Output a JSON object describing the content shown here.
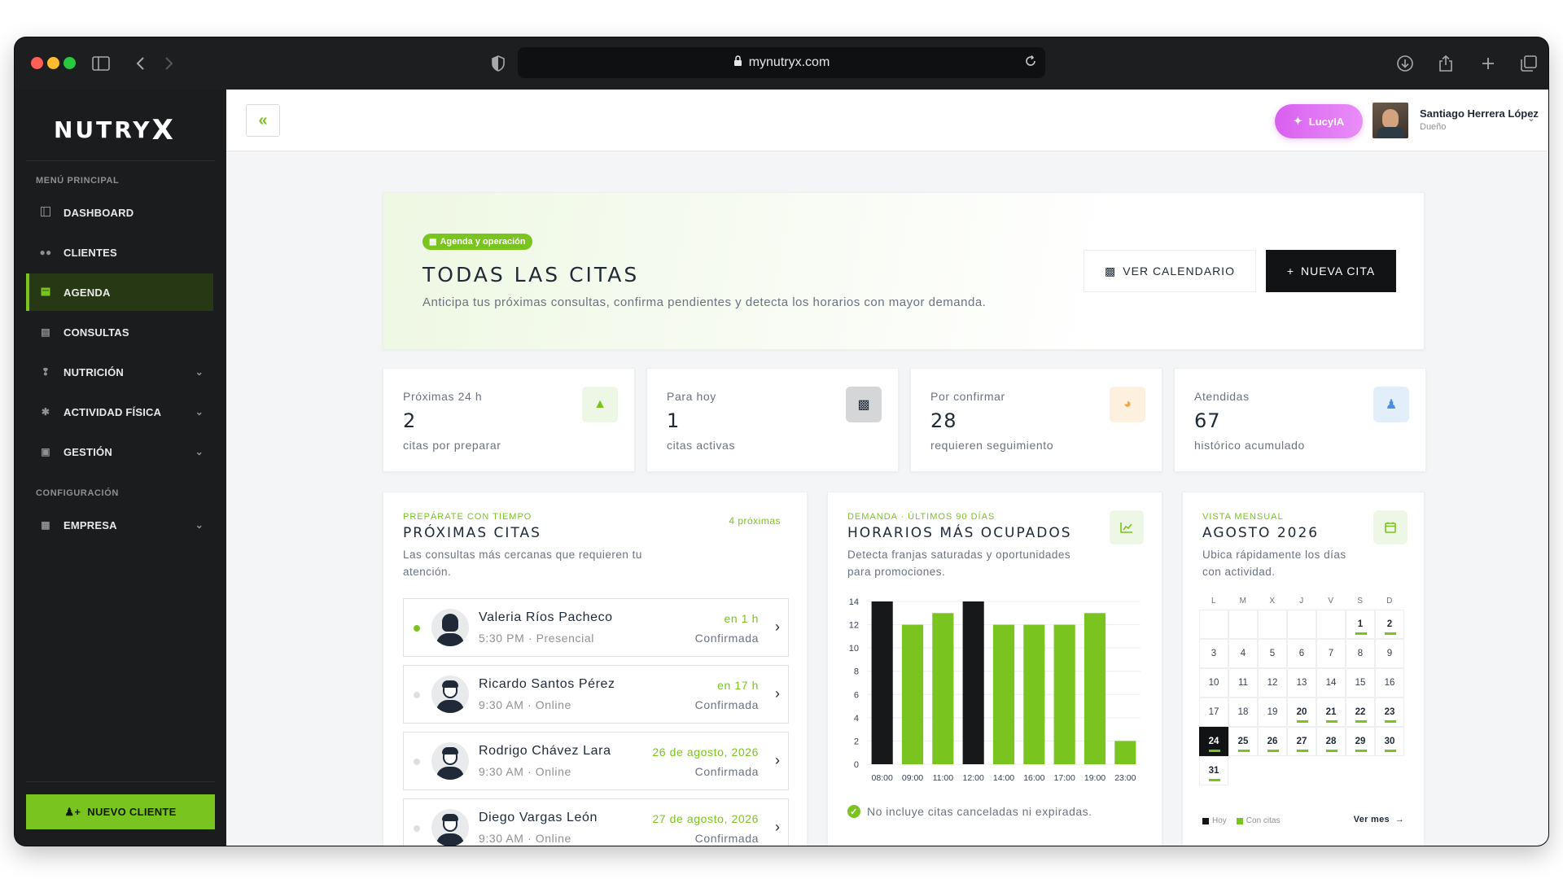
{
  "browser": {
    "url": "mynutryx.com"
  },
  "brand": {
    "logo_text": "NUTRY",
    "logo_x": "X",
    "accent": "#7ac41f",
    "dark": "#1a1c1d"
  },
  "sidebar": {
    "section_main": "MENÚ PRINCIPAL",
    "section_config": "CONFIGURACIÓN",
    "items": [
      {
        "label": "DASHBOARD",
        "icon": "dashboard-icon",
        "active": false,
        "expandable": false
      },
      {
        "label": "CLIENTES",
        "icon": "users-icon",
        "active": false,
        "expandable": false
      },
      {
        "label": "AGENDA",
        "icon": "calendar-icon",
        "active": true,
        "expandable": false
      },
      {
        "label": "CONSULTAS",
        "icon": "clipboard-icon",
        "active": false,
        "expandable": false
      },
      {
        "label": "NUTRICIÓN",
        "icon": "utensils-icon",
        "active": false,
        "expandable": true
      },
      {
        "label": "ACTIVIDAD FÍSICA",
        "icon": "running-icon",
        "active": false,
        "expandable": true
      },
      {
        "label": "GESTIÓN",
        "icon": "briefcase-icon",
        "active": false,
        "expandable": true
      }
    ],
    "config_items": [
      {
        "label": "EMPRESA",
        "icon": "building-icon",
        "expandable": true
      }
    ],
    "new_client_label": "NUEVO CLIENTE"
  },
  "topbar": {
    "lucy_label": "LucyIA",
    "user_name": "Santiago Herrera López",
    "user_role": "Dueño"
  },
  "hero": {
    "badge": "Agenda y operación",
    "title": "TODAS LAS CITAS",
    "subtitle": "Anticipa tus próximas consultas, confirma pendientes y detecta los horarios con mayor demanda.",
    "btn_calendar": "VER CALENDARIO",
    "btn_new": "NUEVA CITA"
  },
  "stats": [
    {
      "label": "Próximas 24 h",
      "value": "2",
      "desc": "citas por preparar",
      "icon": "bell-icon",
      "icon_bg": "#eef6e5",
      "icon_color": "#7ac41f"
    },
    {
      "label": "Para hoy",
      "value": "1",
      "desc": "citas activas",
      "icon": "calendar-day-icon",
      "icon_bg": "#d4d6d8",
      "icon_color": "#1f2937"
    },
    {
      "label": "Por confirmar",
      "value": "28",
      "desc": "requieren seguimiento",
      "icon": "clock-icon",
      "icon_bg": "#fdf0de",
      "icon_color": "#f2a33a"
    },
    {
      "label": "Atendidas",
      "value": "67",
      "desc": "histórico acumulado",
      "icon": "user-check-icon",
      "icon_bg": "#e3eefb",
      "icon_color": "#4a90e2"
    }
  ],
  "upcoming": {
    "eyebrow": "PREPÁRATE CON TIEMPO",
    "title": "PRÓXIMAS CITAS",
    "subtitle_line1": "Las consultas más cercanas que requieren tu",
    "subtitle_line2": "atención.",
    "count_label": "4 próximas",
    "items": [
      {
        "name": "Valeria Ríos Pacheco",
        "meta": "5:30 PM · Presencial",
        "when": "en 1 h",
        "status": "Confirmada",
        "highlight": true,
        "female": true
      },
      {
        "name": "Ricardo Santos Pérez",
        "meta": "9:30 AM · Online",
        "when": "en 17 h",
        "status": "Confirmada",
        "highlight": false,
        "female": false
      },
      {
        "name": "Rodrigo Chávez Lara",
        "meta": "9:30 AM · Online",
        "when": "26 de agosto, 2026",
        "status": "Confirmada",
        "highlight": false,
        "female": false
      },
      {
        "name": "Diego Vargas León",
        "meta": "9:30 AM · Online",
        "when": "27 de agosto, 2026",
        "status": "Confirmada",
        "highlight": false,
        "female": false
      }
    ]
  },
  "busy_hours": {
    "eyebrow": "DEMANDA · ÚLTIMOS 90 DÍAS",
    "title": "HORARIOS MÁS OCUPADOS",
    "subtitle_line1": "Detecta franjas saturadas y oportunidades",
    "subtitle_line2": "para promociones.",
    "note": "No incluye citas canceladas ni expiradas.",
    "icon": "chart-icon"
  },
  "chart_data": {
    "type": "bar",
    "categories": [
      "08:00",
      "09:00",
      "11:00",
      "12:00",
      "14:00",
      "16:00",
      "17:00",
      "19:00",
      "23:00"
    ],
    "values": [
      14,
      12,
      13,
      14,
      12,
      12,
      12,
      13,
      2
    ],
    "highlight": [
      true,
      false,
      false,
      true,
      false,
      false,
      false,
      false,
      false
    ],
    "colors": {
      "peak": "#161819",
      "normal": "#7ac41f"
    },
    "ylim": [
      0,
      14
    ],
    "yticks": [
      0,
      2,
      4,
      6,
      8,
      10,
      12,
      14
    ],
    "title": "",
    "xlabel": "",
    "ylabel": "",
    "grid": true
  },
  "calendar": {
    "eyebrow": "VISTA MENSUAL",
    "title": "AGOSTO 2026",
    "subtitle_line1": "Ubica rápidamente los días",
    "subtitle_line2": "con actividad.",
    "weekdays": [
      "L",
      "M",
      "X",
      "J",
      "V",
      "S",
      "D"
    ],
    "leading_blanks": 5,
    "days_in_month": 31,
    "today": 24,
    "days_with_appointments": [
      1,
      2,
      20,
      21,
      22,
      23,
      24,
      25,
      26,
      27,
      28,
      29,
      30,
      31
    ],
    "legend_today": "Hoy",
    "legend_appts": "Con citas",
    "see_month": "Ver mes"
  }
}
